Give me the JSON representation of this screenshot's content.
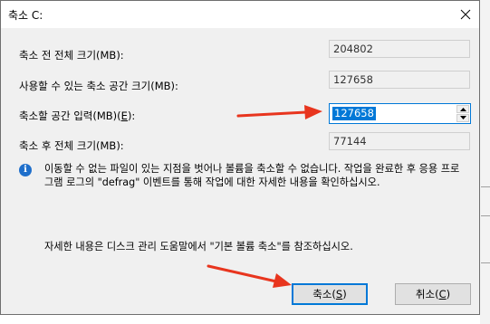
{
  "window": {
    "title": "축소 C:"
  },
  "fields": {
    "total_before_label": "축소 전 전체 크기(MB):",
    "total_before_value": "204802",
    "available_label": "사용할 수 있는 축소 공간 크기(MB):",
    "available_value": "127658",
    "shrink_amount_label": "축소할 공간 입력(MB)(E):",
    "shrink_amount_value": "127658",
    "total_after_label": "축소 후 전체 크기(MB):",
    "total_after_value": "77144"
  },
  "info": {
    "message": "이동할 수 없는 파일이 있는 지점을 벗어나 볼륨을 축소할 수 없습니다. 작업을 완료한 후 응용 프로그램 로그의 \"defrag\" 이벤트를 통해 작업에 대한 자세한 내용을 확인하십시오.",
    "help": "자세한 내용은 디스크 관리 도움말에서 \"기본 볼륨 축소\"를 참조하십시오."
  },
  "buttons": {
    "shrink_label": "축소(S)",
    "cancel_label": "취소(C)"
  },
  "colors": {
    "accent": "#0078d7",
    "arrow": "#e8351e",
    "info_icon": "#1f6fcb"
  },
  "icons": {
    "close": "close-icon",
    "info": "info-icon",
    "spin_up": "chevron-up-icon",
    "spin_down": "chevron-down-icon"
  }
}
